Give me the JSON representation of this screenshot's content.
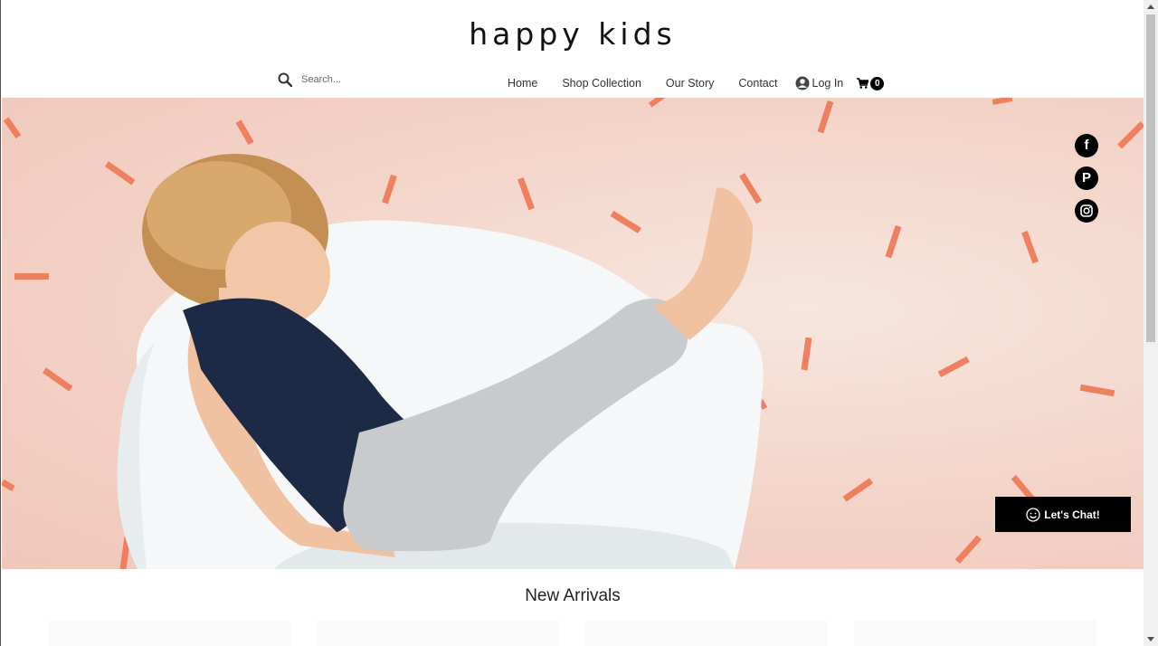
{
  "brand": {
    "name": "happy kids"
  },
  "search": {
    "placeholder": "Search..."
  },
  "nav": {
    "items": [
      {
        "label": "Home"
      },
      {
        "label": "Shop Collection"
      },
      {
        "label": "Our Story"
      },
      {
        "label": "Contact"
      }
    ],
    "login_label": "Log In",
    "cart_count": "0"
  },
  "social": [
    "facebook-icon",
    "pinterest-icon",
    "instagram-icon"
  ],
  "chat": {
    "label": "Let's Chat!"
  },
  "sections": {
    "new_arrivals": "New Arrivals"
  },
  "colors": {
    "accent": "#000000",
    "hero_bg": "#f3d3c7",
    "confetti": "#ee7f5f"
  }
}
